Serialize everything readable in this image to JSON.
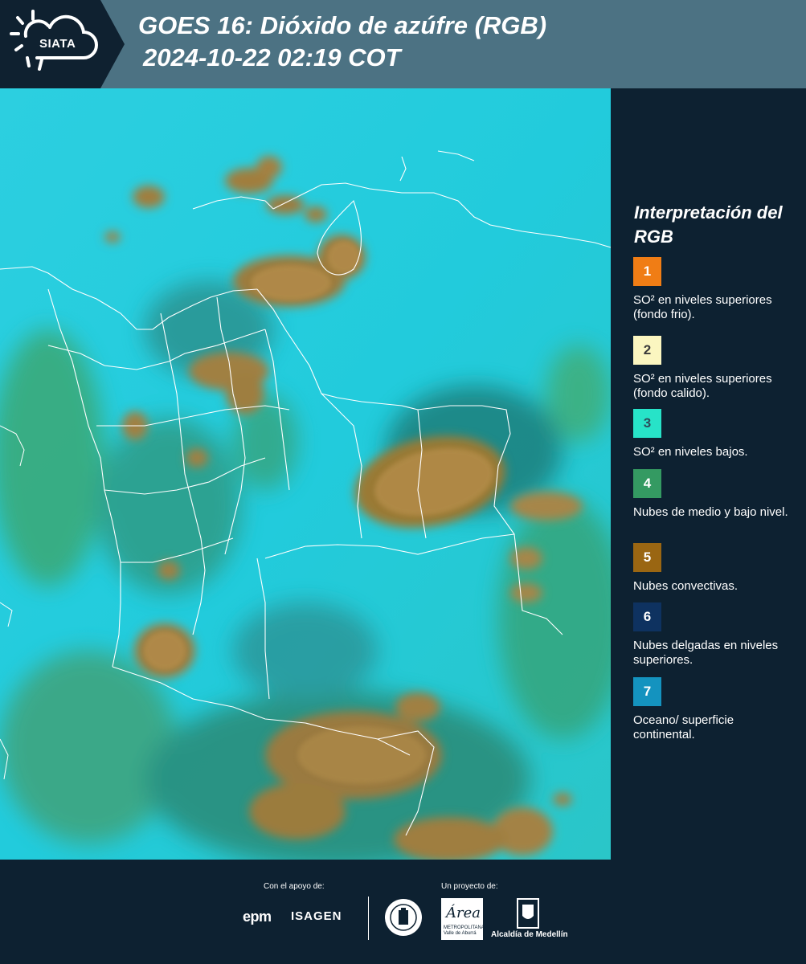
{
  "header": {
    "logo_text": "SIATA",
    "title_line1": "GOES 16: Dióxido de azúfre (RGB)",
    "title_line2": "2024-10-22 02:19 COT"
  },
  "legend": {
    "title": "Interpretación del RGB",
    "items": [
      {
        "number": "1",
        "label": "SO² en niveles superiores (fondo frio).",
        "color": "#f07d15",
        "text_color": "#ffffff"
      },
      {
        "number": "2",
        "label": "SO² en niveles superiores (fondo calido).",
        "color": "#fbf6c0",
        "text_color": "#3a3a3a"
      },
      {
        "number": "3",
        "label": "SO² en niveles bajos.",
        "color": "#27e3c8",
        "text_color": "#2d4b5a"
      },
      {
        "number": "4",
        "label": "Nubes de medio y bajo nivel.",
        "color": "#349a62",
        "text_color": "#ffffff"
      },
      {
        "number": "5",
        "label": "Nubes convectivas.",
        "color": "#9a6612",
        "text_color": "#ffffff"
      },
      {
        "number": "6",
        "label": "Nubes delgadas en niveles superiores.",
        "color": "#0e3260",
        "text_color": "#ffffff"
      },
      {
        "number": "7",
        "label": "Oceano/ superficie continental.",
        "color": "#1493bf",
        "text_color": "#ffffff"
      }
    ]
  },
  "footer": {
    "support_label": "Con el apoyo de:",
    "project_label": "Un proyecto de:",
    "epm_text": "epm",
    "isagen_text": "ISAGEN",
    "amva_script": "Área",
    "amva_sub": "METROPOLITANA Valle de Aburrá",
    "alcaldia_text": "Alcaldía de Medellín"
  }
}
